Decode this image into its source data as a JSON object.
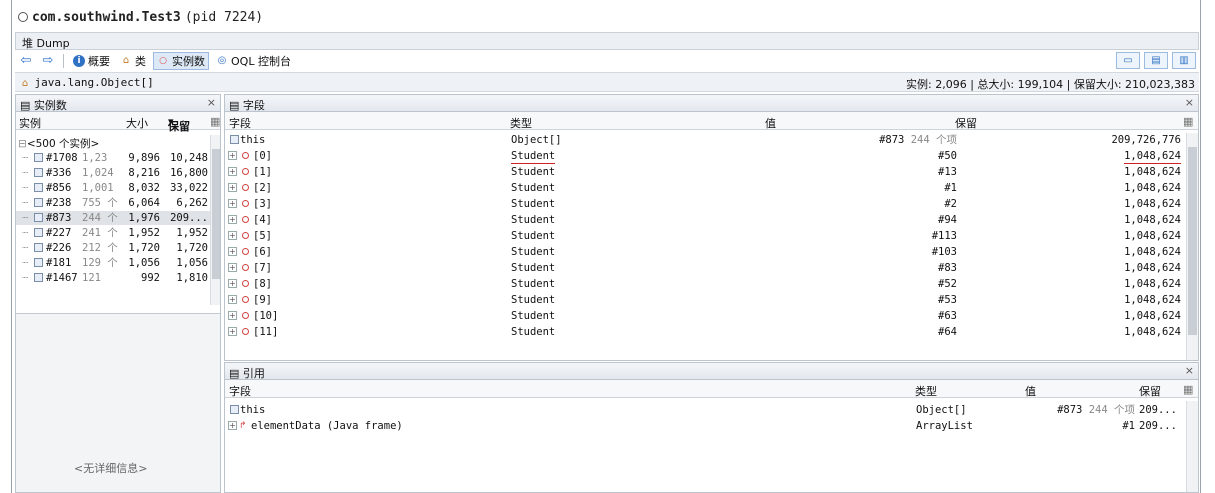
{
  "window": {
    "title_bold": "com.southwind.Test3",
    "title_pid": "(pid 7224)"
  },
  "tab": {
    "label": "堆 Dump"
  },
  "toolbar": {
    "back_icon": "back-arrow-icon",
    "forward_icon": "forward-arrow-icon",
    "summary": "概要",
    "classes": "类",
    "instances": "实例数",
    "oql": "OQL 控制台"
  },
  "classbar": {
    "name": "java.lang.Object[]",
    "summary": "实例: 2,096 | 总大小: 199,104 | 保留大小: 210,023,383"
  },
  "instances_pane": {
    "title": "实例数",
    "columns": {
      "instance": "实例",
      "size": "大小",
      "retained": "保留"
    },
    "group": "<500 个实例>",
    "rows": [
      {
        "id": "#1708",
        "count": "1,23",
        "size": "9,896",
        "retained": "10,248"
      },
      {
        "id": "#336",
        "count": "1,024",
        "size": "8,216",
        "retained": "16,800"
      },
      {
        "id": "#856",
        "count": "1,001",
        "size": "8,032",
        "retained": "33,022"
      },
      {
        "id": "#238",
        "count": "755 个",
        "size": "6,064",
        "retained": "6,262"
      },
      {
        "id": "#873",
        "count": "244 个",
        "size": "1,976",
        "retained": "209..."
      },
      {
        "id": "#227",
        "count": "241 个",
        "size": "1,952",
        "retained": "1,952"
      },
      {
        "id": "#226",
        "count": "212 个",
        "size": "1,720",
        "retained": "1,720"
      },
      {
        "id": "#181",
        "count": "129 个",
        "size": "1,056",
        "retained": "1,056"
      },
      {
        "id": "#1467",
        "count": "121",
        "size": "992",
        "retained": "1,810"
      }
    ],
    "no_detail": "<无详细信息>"
  },
  "fields_pane": {
    "title": "字段",
    "columns": {
      "field": "字段",
      "type": "类型",
      "value": "值",
      "retained": "保留"
    },
    "this_row": {
      "field": "this",
      "type": "Object[]",
      "value": "#873",
      "value_note": "244 个项",
      "retained": "209,726,776"
    },
    "rows": [
      {
        "field": "[0]",
        "type": "Student",
        "value": "#50",
        "retained": "1,048,624"
      },
      {
        "field": "[1]",
        "type": "Student",
        "value": "#13",
        "retained": "1,048,624"
      },
      {
        "field": "[2]",
        "type": "Student",
        "value": "#1",
        "retained": "1,048,624"
      },
      {
        "field": "[3]",
        "type": "Student",
        "value": "#2",
        "retained": "1,048,624"
      },
      {
        "field": "[4]",
        "type": "Student",
        "value": "#94",
        "retained": "1,048,624"
      },
      {
        "field": "[5]",
        "type": "Student",
        "value": "#113",
        "retained": "1,048,624"
      },
      {
        "field": "[6]",
        "type": "Student",
        "value": "#103",
        "retained": "1,048,624"
      },
      {
        "field": "[7]",
        "type": "Student",
        "value": "#83",
        "retained": "1,048,624"
      },
      {
        "field": "[8]",
        "type": "Student",
        "value": "#52",
        "retained": "1,048,624"
      },
      {
        "field": "[9]",
        "type": "Student",
        "value": "#53",
        "retained": "1,048,624"
      },
      {
        "field": "[10]",
        "type": "Student",
        "value": "#63",
        "retained": "1,048,624"
      },
      {
        "field": "[11]",
        "type": "Student",
        "value": "#64",
        "retained": "1,048,624"
      }
    ]
  },
  "refs_pane": {
    "title": "引用",
    "columns": {
      "field": "字段",
      "type": "类型",
      "value": "值",
      "retained": "保留"
    },
    "rows": [
      {
        "field": "this",
        "type": "Object[]",
        "value": "#873",
        "value_note": "244 个项",
        "retained": "209..."
      },
      {
        "field": "elementData (Java frame)",
        "type": "ArrayList",
        "value": "#1",
        "retained": "209..."
      }
    ]
  }
}
